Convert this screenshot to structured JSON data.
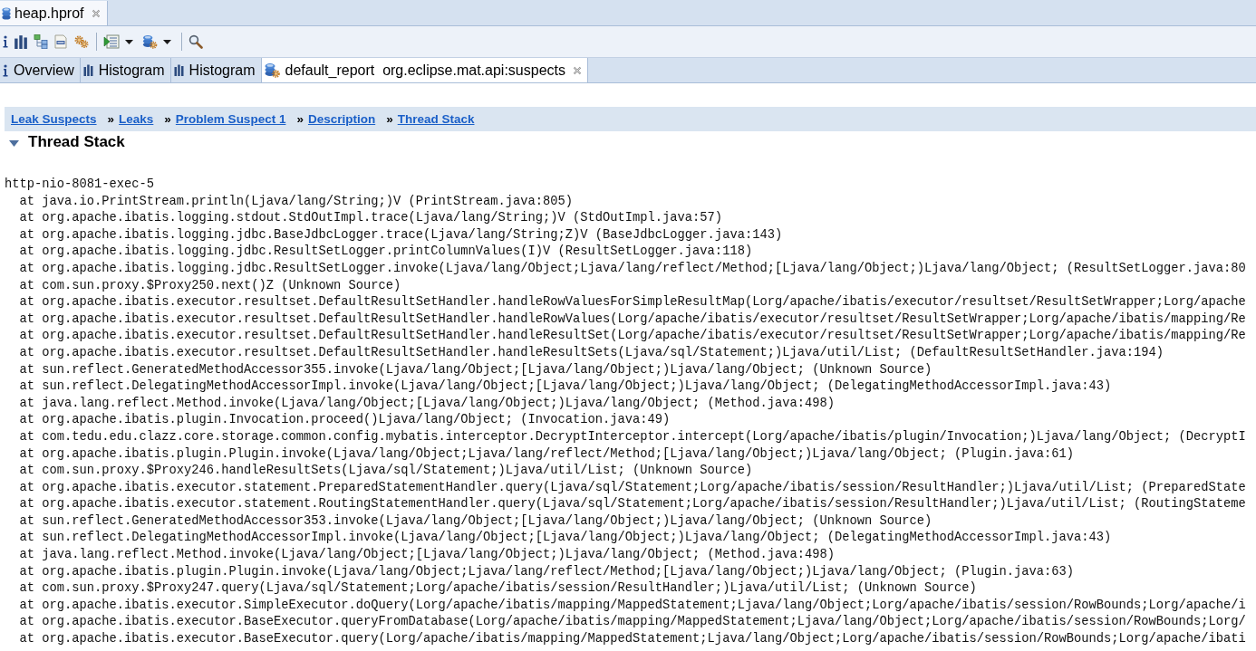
{
  "editor_tabs": [
    {
      "label": "heap.hprof",
      "selected": true
    }
  ],
  "view_tabs": [
    {
      "kind": "overview",
      "label": "Overview",
      "selected": false
    },
    {
      "kind": "histogram",
      "label": "Histogram",
      "selected": false
    },
    {
      "kind": "histogram",
      "label": "Histogram",
      "selected": false
    },
    {
      "kind": "report",
      "label": "default_report  org.eclipse.mat.api:suspects",
      "selected": true
    }
  ],
  "breadcrumb": [
    {
      "label": "Leak Suspects"
    },
    {
      "prefix": "»",
      "label": "Leaks"
    },
    {
      "prefix": "»",
      "label": "Problem Suspect 1"
    },
    {
      "prefix": "»",
      "label": "Description"
    },
    {
      "prefix": "»",
      "label": "Thread Stack"
    }
  ],
  "section": {
    "title": "Thread Stack",
    "expanded": true,
    "thread_name": "http-nio-8081-exec-5",
    "frames": [
      "at java.io.PrintStream.println(Ljava/lang/String;)V (PrintStream.java:805)",
      "at org.apache.ibatis.logging.stdout.StdOutImpl.trace(Ljava/lang/String;)V (StdOutImpl.java:57)",
      "at org.apache.ibatis.logging.jdbc.BaseJdbcLogger.trace(Ljava/lang/String;Z)V (BaseJdbcLogger.java:143)",
      "at org.apache.ibatis.logging.jdbc.ResultSetLogger.printColumnValues(I)V (ResultSetLogger.java:118)",
      "at org.apache.ibatis.logging.jdbc.ResultSetLogger.invoke(Ljava/lang/Object;Ljava/lang/reflect/Method;[Ljava/lang/Object;)Ljava/lang/Object; (ResultSetLogger.java:80",
      "at com.sun.proxy.$Proxy250.next()Z (Unknown Source)",
      "at org.apache.ibatis.executor.resultset.DefaultResultSetHandler.handleRowValuesForSimpleResultMap(Lorg/apache/ibatis/executor/resultset/ResultSetWrapper;Lorg/apache",
      "at org.apache.ibatis.executor.resultset.DefaultResultSetHandler.handleRowValues(Lorg/apache/ibatis/executor/resultset/ResultSetWrapper;Lorg/apache/ibatis/mapping/Re",
      "at org.apache.ibatis.executor.resultset.DefaultResultSetHandler.handleResultSet(Lorg/apache/ibatis/executor/resultset/ResultSetWrapper;Lorg/apache/ibatis/mapping/Re",
      "at org.apache.ibatis.executor.resultset.DefaultResultSetHandler.handleResultSets(Ljava/sql/Statement;)Ljava/util/List; (DefaultResultSetHandler.java:194)",
      "at sun.reflect.GeneratedMethodAccessor355.invoke(Ljava/lang/Object;[Ljava/lang/Object;)Ljava/lang/Object; (Unknown Source)",
      "at sun.reflect.DelegatingMethodAccessorImpl.invoke(Ljava/lang/Object;[Ljava/lang/Object;)Ljava/lang/Object; (DelegatingMethodAccessorImpl.java:43)",
      "at java.lang.reflect.Method.invoke(Ljava/lang/Object;[Ljava/lang/Object;)Ljava/lang/Object; (Method.java:498)",
      "at org.apache.ibatis.plugin.Invocation.proceed()Ljava/lang/Object; (Invocation.java:49)",
      "at com.tedu.edu.clazz.core.storage.common.config.mybatis.interceptor.DecryptInterceptor.intercept(Lorg/apache/ibatis/plugin/Invocation;)Ljava/lang/Object; (DecryptI",
      "at org.apache.ibatis.plugin.Plugin.invoke(Ljava/lang/Object;Ljava/lang/reflect/Method;[Ljava/lang/Object;)Ljava/lang/Object; (Plugin.java:61)",
      "at com.sun.proxy.$Proxy246.handleResultSets(Ljava/sql/Statement;)Ljava/util/List; (Unknown Source)",
      "at org.apache.ibatis.executor.statement.PreparedStatementHandler.query(Ljava/sql/Statement;Lorg/apache/ibatis/session/ResultHandler;)Ljava/util/List; (PreparedState",
      "at org.apache.ibatis.executor.statement.RoutingStatementHandler.query(Ljava/sql/Statement;Lorg/apache/ibatis/session/ResultHandler;)Ljava/util/List; (RoutingStateme",
      "at sun.reflect.GeneratedMethodAccessor353.invoke(Ljava/lang/Object;[Ljava/lang/Object;)Ljava/lang/Object; (Unknown Source)",
      "at sun.reflect.DelegatingMethodAccessorImpl.invoke(Ljava/lang/Object;[Ljava/lang/Object;)Ljava/lang/Object; (DelegatingMethodAccessorImpl.java:43)",
      "at java.lang.reflect.Method.invoke(Ljava/lang/Object;[Ljava/lang/Object;)Ljava/lang/Object; (Method.java:498)",
      "at org.apache.ibatis.plugin.Plugin.invoke(Ljava/lang/Object;Ljava/lang/reflect/Method;[Ljava/lang/Object;)Ljava/lang/Object; (Plugin.java:63)",
      "at com.sun.proxy.$Proxy247.query(Ljava/sql/Statement;Lorg/apache/ibatis/session/ResultHandler;)Ljava/util/List; (Unknown Source)",
      "at org.apache.ibatis.executor.SimpleExecutor.doQuery(Lorg/apache/ibatis/mapping/MappedStatement;Ljava/lang/Object;Lorg/apache/ibatis/session/RowBounds;Lorg/apache/i",
      "at org.apache.ibatis.executor.BaseExecutor.queryFromDatabase(Lorg/apache/ibatis/mapping/MappedStatement;Ljava/lang/Object;Lorg/apache/ibatis/session/RowBounds;Lorg/",
      "at org.apache.ibatis.executor.BaseExecutor.query(Lorg/apache/ibatis/mapping/MappedStatement;Ljava/lang/Object;Lorg/apache/ibatis/session/RowBounds;Lorg/apache/ibati"
    ]
  }
}
